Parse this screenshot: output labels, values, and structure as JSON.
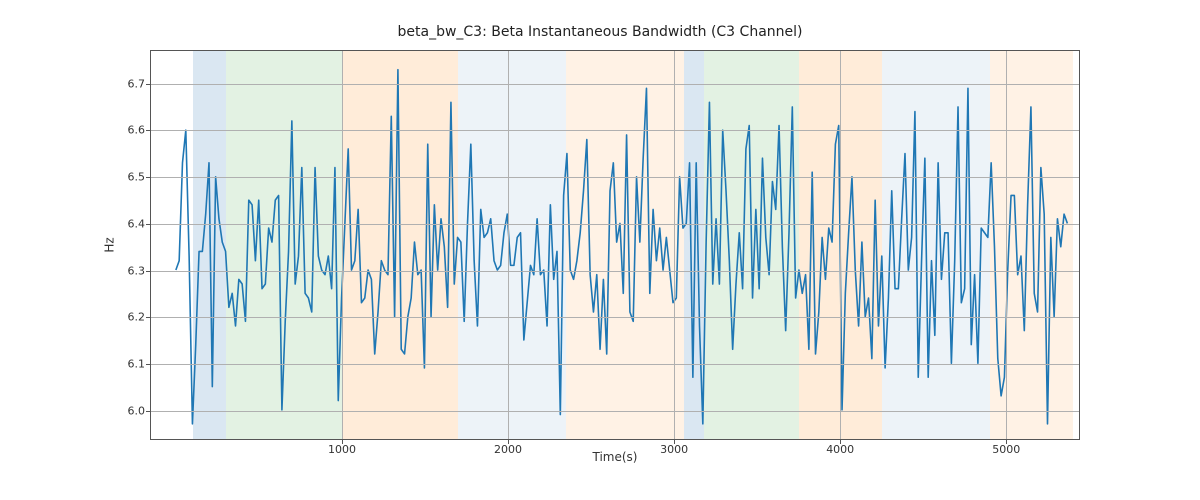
{
  "chart_data": {
    "type": "line",
    "title": "beta_bw_C3: Beta Instantaneous Bandwidth (C3 Channel)",
    "xlabel": "Time(s)",
    "ylabel": "Hz",
    "xlim": [
      -150,
      5450
    ],
    "ylim": [
      5.935,
      6.77
    ],
    "xticks": [
      1000,
      2000,
      3000,
      4000,
      5000
    ],
    "yticks": [
      6.0,
      6.1,
      6.2,
      6.3,
      6.4,
      6.5,
      6.6,
      6.7
    ],
    "bands": [
      {
        "x0": 100,
        "x1": 300,
        "color": "#b6d0e6"
      },
      {
        "x0": 300,
        "x1": 1000,
        "color": "#c7e6c7"
      },
      {
        "x0": 1000,
        "x1": 1700,
        "color": "#ffd9b3"
      },
      {
        "x0": 1700,
        "x1": 2350,
        "color": "#dbe7f2"
      },
      {
        "x0": 2350,
        "x1": 3060,
        "color": "#ffe6cc"
      },
      {
        "x0": 3060,
        "x1": 3180,
        "color": "#b6d0e6"
      },
      {
        "x0": 3180,
        "x1": 3750,
        "color": "#c7e6c7"
      },
      {
        "x0": 3750,
        "x1": 4250,
        "color": "#ffd9b3"
      },
      {
        "x0": 4250,
        "x1": 4900,
        "color": "#dbe7f2"
      },
      {
        "x0": 4900,
        "x1": 5400,
        "color": "#ffe6cc"
      }
    ],
    "x": [
      0,
      20,
      40,
      60,
      80,
      100,
      120,
      140,
      160,
      180,
      200,
      220,
      240,
      260,
      280,
      300,
      320,
      340,
      360,
      380,
      400,
      420,
      440,
      460,
      480,
      500,
      520,
      540,
      560,
      580,
      600,
      620,
      640,
      660,
      680,
      700,
      720,
      740,
      760,
      780,
      800,
      820,
      840,
      860,
      880,
      900,
      920,
      940,
      960,
      980,
      1000,
      1020,
      1040,
      1060,
      1080,
      1100,
      1120,
      1140,
      1160,
      1180,
      1200,
      1220,
      1240,
      1260,
      1280,
      1300,
      1320,
      1340,
      1360,
      1380,
      1400,
      1420,
      1440,
      1460,
      1480,
      1500,
      1520,
      1540,
      1560,
      1580,
      1600,
      1620,
      1640,
      1660,
      1680,
      1700,
      1720,
      1740,
      1760,
      1780,
      1800,
      1820,
      1840,
      1860,
      1880,
      1900,
      1920,
      1940,
      1960,
      1980,
      2000,
      2020,
      2040,
      2060,
      2080,
      2100,
      2120,
      2140,
      2160,
      2180,
      2200,
      2220,
      2240,
      2260,
      2280,
      2300,
      2320,
      2340,
      2360,
      2380,
      2400,
      2420,
      2440,
      2460,
      2480,
      2500,
      2520,
      2540,
      2560,
      2580,
      2600,
      2620,
      2640,
      2660,
      2680,
      2700,
      2720,
      2740,
      2760,
      2780,
      2800,
      2820,
      2840,
      2860,
      2880,
      2900,
      2920,
      2940,
      2960,
      2980,
      3000,
      3020,
      3040,
      3060,
      3080,
      3100,
      3120,
      3140,
      3160,
      3180,
      3200,
      3220,
      3240,
      3260,
      3280,
      3300,
      3320,
      3340,
      3360,
      3380,
      3400,
      3420,
      3440,
      3460,
      3480,
      3500,
      3520,
      3540,
      3560,
      3580,
      3600,
      3620,
      3640,
      3660,
      3680,
      3700,
      3720,
      3740,
      3760,
      3780,
      3800,
      3820,
      3840,
      3860,
      3880,
      3900,
      3920,
      3940,
      3960,
      3980,
      4000,
      4020,
      4040,
      4060,
      4080,
      4100,
      4120,
      4140,
      4160,
      4180,
      4200,
      4220,
      4240,
      4260,
      4280,
      4300,
      4320,
      4340,
      4360,
      4380,
      4400,
      4420,
      4440,
      4460,
      4480,
      4500,
      4520,
      4540,
      4560,
      4580,
      4600,
      4620,
      4640,
      4660,
      4680,
      4700,
      4720,
      4740,
      4760,
      4780,
      4800,
      4820,
      4840,
      4860,
      4880,
      4900,
      4920,
      4940,
      4960,
      4980,
      5000,
      5020,
      5040,
      5060,
      5080,
      5100,
      5120,
      5140,
      5160,
      5180,
      5200,
      5220,
      5240,
      5260,
      5280,
      5300,
      5320,
      5340,
      5360,
      5380
    ],
    "values": [
      6.3,
      6.32,
      6.53,
      6.6,
      6.33,
      5.97,
      6.14,
      6.34,
      6.34,
      6.42,
      6.53,
      6.05,
      6.5,
      6.41,
      6.36,
      6.34,
      6.22,
      6.25,
      6.18,
      6.28,
      6.27,
      6.19,
      6.45,
      6.44,
      6.32,
      6.45,
      6.26,
      6.27,
      6.39,
      6.36,
      6.45,
      6.46,
      6.0,
      6.19,
      6.34,
      6.62,
      6.27,
      6.33,
      6.52,
      6.25,
      6.24,
      6.21,
      6.52,
      6.33,
      6.3,
      6.29,
      6.33,
      6.26,
      6.52,
      6.02,
      6.24,
      6.4,
      6.56,
      6.3,
      6.32,
      6.43,
      6.23,
      6.24,
      6.3,
      6.28,
      6.12,
      6.21,
      6.32,
      6.3,
      6.29,
      6.63,
      6.2,
      6.73,
      6.13,
      6.12,
      6.2,
      6.24,
      6.36,
      6.29,
      6.3,
      6.09,
      6.57,
      6.2,
      6.44,
      6.3,
      6.41,
      6.35,
      6.22,
      6.66,
      6.27,
      6.37,
      6.36,
      6.19,
      6.4,
      6.57,
      6.32,
      6.18,
      6.43,
      6.37,
      6.38,
      6.41,
      6.32,
      6.3,
      6.31,
      6.38,
      6.42,
      6.31,
      6.31,
      6.37,
      6.38,
      6.15,
      6.23,
      6.31,
      6.29,
      6.41,
      6.29,
      6.3,
      6.18,
      6.44,
      6.28,
      6.34,
      5.99,
      6.46,
      6.55,
      6.3,
      6.28,
      6.32,
      6.38,
      6.47,
      6.58,
      6.29,
      6.21,
      6.29,
      6.13,
      6.28,
      6.12,
      6.47,
      6.53,
      6.36,
      6.4,
      6.25,
      6.59,
      6.21,
      6.19,
      6.5,
      6.36,
      6.54,
      6.69,
      6.25,
      6.43,
      6.32,
      6.39,
      6.3,
      6.37,
      6.3,
      6.23,
      6.24,
      6.5,
      6.39,
      6.4,
      6.53,
      6.07,
      6.53,
      6.18,
      5.97,
      6.36,
      6.66,
      6.27,
      6.41,
      6.27,
      6.6,
      6.47,
      6.32,
      6.13,
      6.27,
      6.38,
      6.26,
      6.56,
      6.61,
      6.24,
      6.43,
      6.26,
      6.54,
      6.37,
      6.29,
      6.49,
      6.43,
      6.61,
      6.35,
      6.17,
      6.38,
      6.65,
      6.24,
      6.3,
      6.25,
      6.29,
      6.13,
      6.51,
      6.12,
      6.21,
      6.37,
      6.28,
      6.39,
      6.36,
      6.57,
      6.61,
      6.0,
      6.25,
      6.38,
      6.5,
      6.3,
      6.18,
      6.36,
      6.2,
      6.24,
      6.11,
      6.45,
      6.18,
      6.33,
      6.09,
      6.24,
      6.47,
      6.26,
      6.26,
      6.41,
      6.55,
      6.3,
      6.37,
      6.64,
      6.07,
      6.32,
      6.54,
      6.07,
      6.32,
      6.16,
      6.53,
      6.28,
      6.38,
      6.38,
      6.1,
      6.32,
      6.65,
      6.23,
      6.26,
      6.69,
      6.14,
      6.29,
      6.1,
      6.39,
      6.38,
      6.37,
      6.53,
      6.35,
      6.11,
      6.03,
      6.07,
      6.3,
      6.46,
      6.46,
      6.29,
      6.33,
      6.17,
      6.44,
      6.65,
      6.25,
      6.21,
      6.52,
      6.42,
      5.97,
      6.37,
      6.2,
      6.41,
      6.35,
      6.42,
      6.4
    ]
  }
}
